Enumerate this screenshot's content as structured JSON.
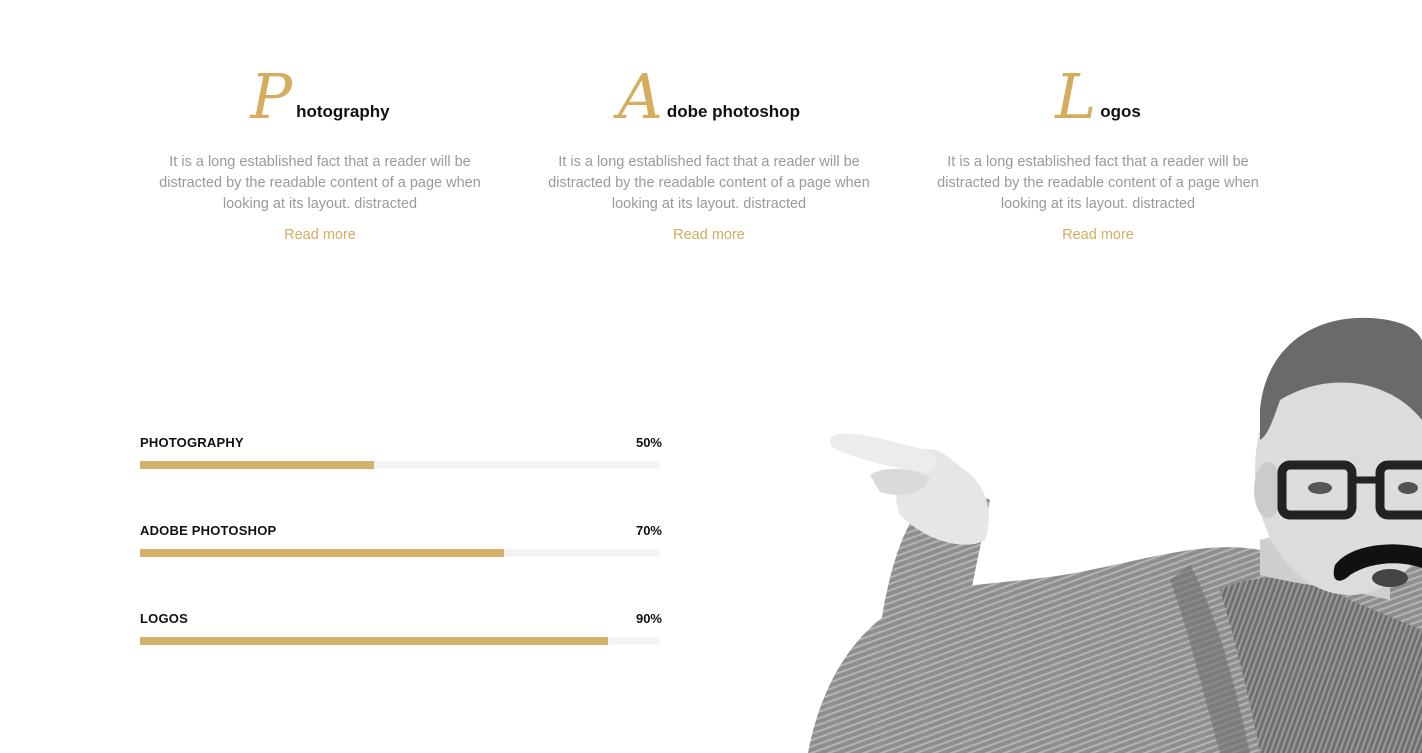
{
  "services": [
    {
      "initial": "P",
      "title_rest": "hotography",
      "text": "It is a long established fact that a reader will be distracted by the readable content of a page when looking at its layout. distracted",
      "link": "Read more"
    },
    {
      "initial": "A",
      "title_rest": "dobe photoshop",
      "text": "It is a long established fact that a reader will be distracted by the readable content of a page when looking at its layout. distracted",
      "link": "Read more"
    },
    {
      "initial": "L",
      "title_rest": "ogos",
      "text": "It is a long established fact that a reader will be distracted by the readable content of a page when looking at its layout. distracted",
      "link": "Read more"
    }
  ],
  "skills": [
    {
      "name": "PHOTOGRAPHY",
      "percent_label": "50%",
      "fill_fraction": 0.45
    },
    {
      "name": "ADOBE PHOTOSHOP",
      "percent_label": "70%",
      "fill_fraction": 0.7
    },
    {
      "name": "LOGOS",
      "percent_label": "90%",
      "fill_fraction": 0.9
    }
  ],
  "colors": {
    "accent": "#d4ad5f",
    "bar_fill": "#d4b169",
    "bar_track": "#f3f3f3",
    "body_text": "#9a9a9a",
    "heading": "#111111"
  },
  "image": {
    "subject": "man-with-moustache-and-glasses-pointing"
  }
}
